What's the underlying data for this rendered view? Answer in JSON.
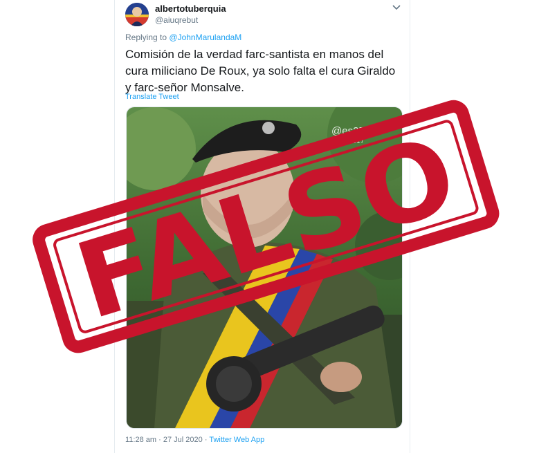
{
  "tweet": {
    "display_name": "albertotuberquia",
    "handle": "@aiuqrebut",
    "reply_prefix": "Replying to",
    "reply_to": "@JohnMarulandaM",
    "text": "Comisión de la verdad farc-santista en manos del cura miliciano De Roux, ya solo falta el cura Giraldo y farc-señor Monsalve.",
    "translate_label": "Translate Tweet",
    "time": "11:28 am",
    "date": "27 Jul 2020",
    "separator": "·",
    "source": "Twitter Web App",
    "menu_icon": "chevron-down-icon"
  },
  "media": {
    "watermark_handle": "@es2506",
    "watermark_date": "10 ... 2017"
  },
  "stamp": {
    "word": "FALSO",
    "color": "#c8142c"
  },
  "colors": {
    "link": "#1da1f2",
    "muted": "#657786",
    "text": "#14171a"
  }
}
